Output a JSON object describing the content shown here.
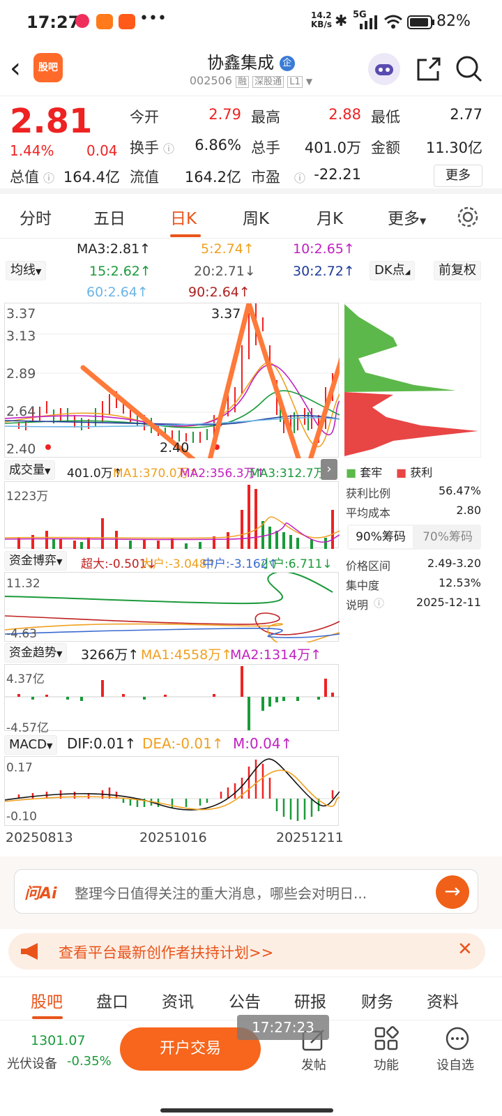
{
  "status": {
    "time": "17:27",
    "net": "14.2 KB/s",
    "signal": "5G",
    "battery": "82%"
  },
  "header": {
    "logo": "股吧",
    "name": "协鑫集成",
    "code": "002506",
    "tags": [
      "融",
      "深股通",
      "L1"
    ]
  },
  "quote": {
    "price": "2.81",
    "pct": "1.44%",
    "change": "0.04",
    "cells": [
      {
        "label": "今开",
        "value": "2.79",
        "red": true
      },
      {
        "label": "最高",
        "value": "2.88",
        "red": true
      },
      {
        "label": "最低",
        "value": "2.77",
        "red": false
      },
      {
        "label": "换手",
        "value": "6.86%",
        "red": false
      },
      {
        "label": "总手",
        "value": "401.0万",
        "red": false
      },
      {
        "label": "金额",
        "value": "11.30亿",
        "red": false
      },
      {
        "label": "总值",
        "value": "164.4亿",
        "red": false
      },
      {
        "label": "流值",
        "value": "164.2亿",
        "red": false
      },
      {
        "label": "市盈",
        "value": "-22.21",
        "red": false
      }
    ],
    "more": "更多"
  },
  "ktabs": [
    "分时",
    "五日",
    "日K",
    "周K",
    "月K",
    "更多"
  ],
  "ma": {
    "ma3": "MA3:2.81↑",
    "ma5": "5:2.74↑",
    "ma10": "10:2.65↑",
    "ma15": "15:2.62↑",
    "ma20": "20:2.71↓",
    "ma30": "30:2.72↑",
    "ma60": "60:2.64↑",
    "ma90": "90:2.64↑",
    "junxian": "均线",
    "dk": "DK点",
    "fq": "前复权"
  },
  "kchart": {
    "y_labels": [
      "3.37",
      "3.13",
      "2.89",
      "2.64",
      "2.40"
    ],
    "high_mark": "3.37",
    "low_mark": "2.40",
    "cost_legend": [
      "套牢",
      "获利"
    ]
  },
  "volume": {
    "label": "成交量",
    "v": "401.0万↑",
    "ma1": "MA1:370.0万↑",
    "ma2": "MA2:356.3万↑",
    "ma3": "MA3:312.7万↑",
    "ymax": "1223万"
  },
  "fund_game": {
    "label": "资金博弈",
    "super": "超大:-0.501↓",
    "big": "大户:-3.048↑",
    "mid": "中户:-3.162↑",
    "small": "小户:6.711↓",
    "ymax": "11.32",
    "ymin": "-4.63"
  },
  "fund_trend": {
    "label": "资金趋势",
    "v": "3266万↑",
    "ma1": "MA1:4558万↑",
    "ma2": "MA2:1314万↑",
    "ymax": "4.37亿",
    "ymin": "-4.57亿"
  },
  "macd": {
    "label": "MACD",
    "dif": "DIF:0.01↑",
    "dea": "DEA:-0.01↑",
    "m": "M:0.04↑",
    "ymax": "0.17",
    "ymin": "-0.10",
    "dates": [
      "20250813",
      "20251016",
      "20251211"
    ]
  },
  "chips": {
    "ratio_label": "获利比例",
    "ratio": "56.47%",
    "avg_label": "平均成本",
    "avg": "2.80",
    "tab90": "90%筹码",
    "tab70": "70%筹码",
    "range_label": "价格区间",
    "range": "2.49-3.20",
    "conc_label": "集中度",
    "conc": "12.53%",
    "note_label": "说明",
    "note": "2025-12-11"
  },
  "ask": {
    "brand": "问Ai",
    "placeholder": "整理今日值得关注的重大消息，哪些会对明日..."
  },
  "notice": "查看平台最新创作者扶持计划>>",
  "bottom_tabs": [
    "股吧",
    "盘口",
    "资讯",
    "公告",
    "研报",
    "财务",
    "资料"
  ],
  "nav": {
    "index_value": "1301.07",
    "index_name": "光伏设备",
    "index_change": "-0.35%",
    "trade": "开户交易",
    "post": "发帖",
    "func": "功能",
    "watch": "设自选",
    "overlay_time": "17:27:23"
  },
  "colors": {
    "accent": "#e9541b",
    "up": "#e22222",
    "down": "#1a9a3a"
  }
}
